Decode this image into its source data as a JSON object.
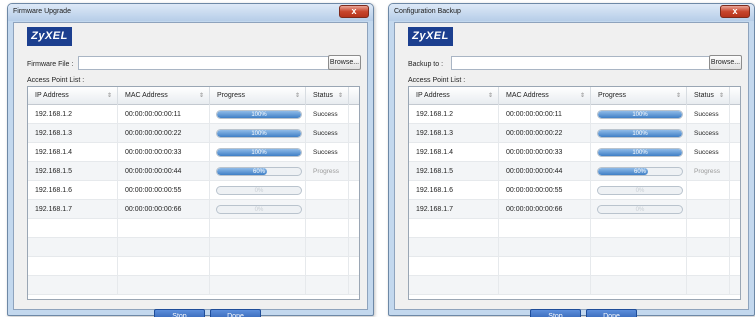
{
  "windows": [
    {
      "title": "Firmware Upgrade",
      "logo_text": "ZyXEL",
      "field_label": "Firmware File :",
      "field_value": "",
      "browse_label": "Browse...",
      "list_label": "Access Point List :",
      "columns": [
        "IP Address",
        "MAC Address",
        "Progress",
        "Status"
      ],
      "rows": [
        {
          "ip": "192.168.1.2",
          "mac": "00:00:00:00:00:11",
          "progress": 100,
          "progress_label": "100%",
          "status": "Success"
        },
        {
          "ip": "192.168.1.3",
          "mac": "00:00:00:00:00:22",
          "progress": 100,
          "progress_label": "100%",
          "status": "Success"
        },
        {
          "ip": "192.168.1.4",
          "mac": "00:00:00:00:00:33",
          "progress": 100,
          "progress_label": "100%",
          "status": "Success"
        },
        {
          "ip": "192.168.1.5",
          "mac": "00:00:00:00:00:44",
          "progress": 60,
          "progress_label": "60%",
          "status": "Progress"
        },
        {
          "ip": "192.168.1.6",
          "mac": "00:00:00:00:00:55",
          "progress": 0,
          "progress_label": "0%",
          "status": ""
        },
        {
          "ip": "192.168.1.7",
          "mac": "00:00:00:00:00:66",
          "progress": 0,
          "progress_label": "0%",
          "status": ""
        }
      ],
      "stop_label": "Stop",
      "done_label": "Done"
    },
    {
      "title": "Configuration Backup",
      "logo_text": "ZyXEL",
      "field_label": "Backup to :",
      "field_value": "",
      "browse_label": "Browse...",
      "list_label": "Access Point List :",
      "columns": [
        "IP Address",
        "MAC Address",
        "Progress",
        "Status"
      ],
      "rows": [
        {
          "ip": "192.168.1.2",
          "mac": "00:00:00:00:00:11",
          "progress": 100,
          "progress_label": "100%",
          "status": "Success"
        },
        {
          "ip": "192.168.1.3",
          "mac": "00:00:00:00:00:22",
          "progress": 100,
          "progress_label": "100%",
          "status": "Success"
        },
        {
          "ip": "192.168.1.4",
          "mac": "00:00:00:00:00:33",
          "progress": 100,
          "progress_label": "100%",
          "status": "Success"
        },
        {
          "ip": "192.168.1.5",
          "mac": "00:00:00:00:00:44",
          "progress": 60,
          "progress_label": "60%",
          "status": "Progress"
        },
        {
          "ip": "192.168.1.6",
          "mac": "00:00:00:00:00:55",
          "progress": 0,
          "progress_label": "0%",
          "status": ""
        },
        {
          "ip": "192.168.1.7",
          "mac": "00:00:00:00:00:66",
          "progress": 0,
          "progress_label": "0%",
          "status": ""
        }
      ],
      "stop_label": "Stop",
      "done_label": "Done"
    }
  ],
  "close_glyph": "x",
  "sort_glyph": "⇕",
  "colors": {
    "brand": "#1c3f8f",
    "accent_button": "#2f62b6",
    "progress_fill": "#3f7fc6"
  }
}
